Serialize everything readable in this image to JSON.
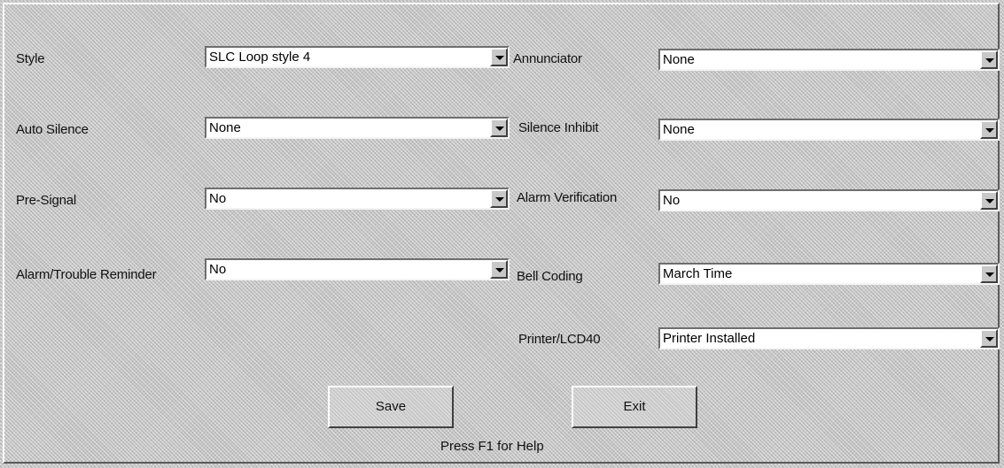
{
  "fields": {
    "style": {
      "label": "Style",
      "value": "SLC Loop style 4"
    },
    "annunciator": {
      "label": "Annunciator",
      "value": "None"
    },
    "auto_silence": {
      "label": "Auto Silence",
      "value": "None"
    },
    "silence_inhibit": {
      "label": "Silence Inhibit",
      "value": "None"
    },
    "pre_signal": {
      "label": "Pre-Signal",
      "value": "No"
    },
    "alarm_verification": {
      "label": "Alarm Verification",
      "value": "No"
    },
    "alarm_trouble_reminder": {
      "label": "Alarm/Trouble Reminder",
      "value": "No"
    },
    "bell_coding": {
      "label": "Bell Coding",
      "value": "March Time"
    },
    "printer_lcd40": {
      "label": "Printer/LCD40",
      "value": "Printer Installed"
    }
  },
  "buttons": {
    "save": "Save",
    "exit": "Exit"
  },
  "help_text": "Press F1 for Help",
  "colors": {
    "background": "#c4c4c4",
    "field": "#ffffff"
  },
  "icons": {
    "dropdown": "chevron-down-icon"
  }
}
